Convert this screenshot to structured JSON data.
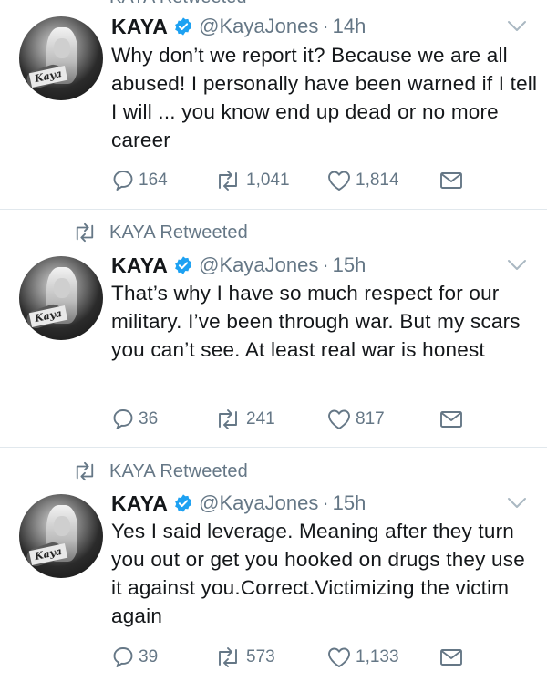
{
  "top": {
    "retweeted_label": "KAYA Retweeted"
  },
  "tweets": [
    {
      "retweeted_label": "",
      "name": "KAYA",
      "handle": "@KayaJones",
      "dot": "·",
      "time": "14h",
      "avatar_text": "Kaya",
      "text": "Why don’t we report it? Because we are all abused! I personally have been warned if I tell I will ... you know end up dead or no more career",
      "replies": "164",
      "retweets": "1,041",
      "likes": "1,814"
    },
    {
      "retweeted_label": "KAYA Retweeted",
      "name": "KAYA",
      "handle": "@KayaJones",
      "dot": "·",
      "time": "15h",
      "avatar_text": "Kaya",
      "text": "That’s why I have so much respect for our military. I’ve been through war. But my scars you can’t see. At least real war is honest",
      "replies": "36",
      "retweets": "241",
      "likes": "817"
    },
    {
      "retweeted_label": "KAYA Retweeted",
      "name": "KAYA",
      "handle": "@KayaJones",
      "dot": "·",
      "time": "15h",
      "avatar_text": "Kaya",
      "text": "Yes I said leverage. Meaning after they turn you out or get you hooked on drugs they use it against you.Correct.Victimizing the victim again",
      "replies": "39",
      "retweets": "573",
      "likes": "1,133"
    }
  ],
  "colors": {
    "text": "#14171a",
    "muted": "#657786",
    "verified": "#1da1f2",
    "divider": "#e1e8ed"
  },
  "icons": [
    "retweet-icon",
    "verified-badge-icon",
    "chevron-down-icon",
    "reply-icon",
    "like-icon",
    "message-icon"
  ]
}
